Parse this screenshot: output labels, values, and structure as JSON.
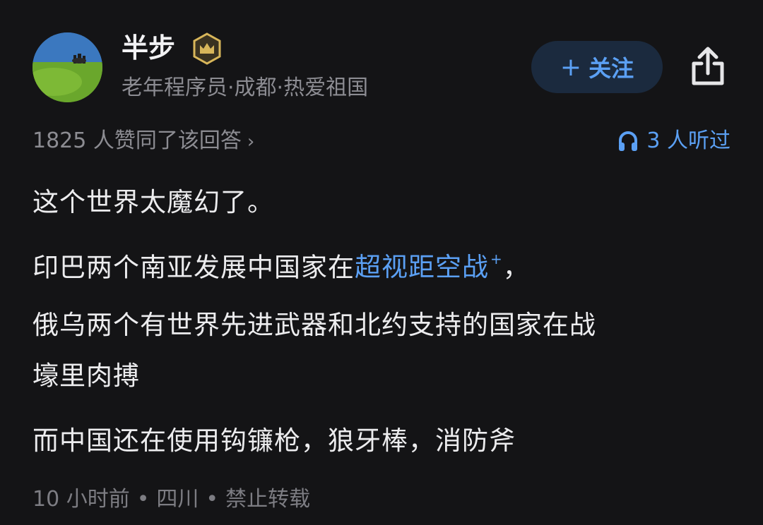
{
  "author": {
    "name": "半步",
    "badge_icon": "crown-badge-icon",
    "description": "老年程序员·成都·热爱祖国",
    "avatar_icon": "avatar-landscape-icon"
  },
  "actions": {
    "follow_plus": "+",
    "follow_label": "关注",
    "share_icon": "share-icon"
  },
  "stats": {
    "likes_text": "1825 人赞同了该回答",
    "chevron": "›",
    "listen_text": "3 人听过",
    "listen_icon": "headphones-icon"
  },
  "content": {
    "p1": "这个世界太魔幻了。",
    "p2_before": "印巴两个南亚发展中国家在",
    "p2_link": "超视距空战",
    "p2_link_mark": "+",
    "p2_after": "，",
    "p3_line1": "俄乌两个有世界先进武器和北约支持的国家在战",
    "p3_line2": "壕里肉搏",
    "p4": "而中国还在使用钩镰枪，狼牙棒，消防斧"
  },
  "footer": {
    "time": "10 小时前",
    "sep1": "•",
    "location": "四川",
    "sep2": "•",
    "repost": "禁止转载"
  },
  "colors": {
    "background": "#141416",
    "accent": "#5ba0f4",
    "follow_bg": "#1b2a3e",
    "muted": "#8c8c92",
    "badge_gold": "#d8b65a"
  }
}
